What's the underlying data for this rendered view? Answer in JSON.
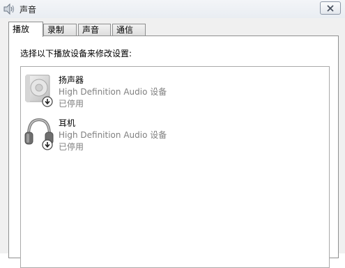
{
  "window": {
    "title": "声音"
  },
  "tabs": [
    {
      "label": "播放",
      "active": true
    },
    {
      "label": "录制",
      "active": false
    },
    {
      "label": "声音",
      "active": false
    },
    {
      "label": "通信",
      "active": false
    }
  ],
  "playback": {
    "instruction": "选择以下播放设备来修改设置:",
    "devices": [
      {
        "name": "扬声器",
        "description": "High Definition Audio 设备",
        "status": "已停用",
        "icon": "speaker-icon"
      },
      {
        "name": "耳机",
        "description": "High Definition Audio 设备",
        "status": "已停用",
        "icon": "headphones-icon"
      }
    ]
  },
  "colors": {
    "disabled_text": "#808080",
    "disabled_badge": "#4a4a4a"
  }
}
